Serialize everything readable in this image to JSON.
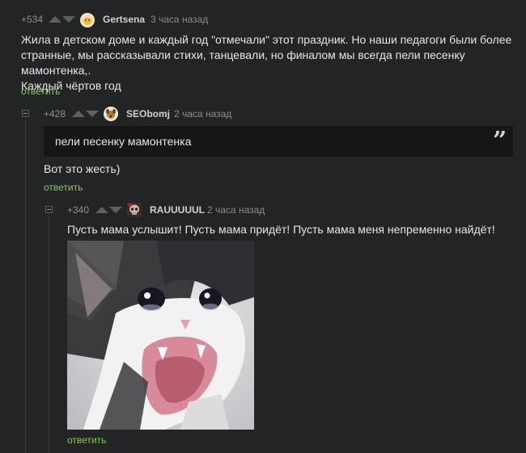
{
  "comments": [
    {
      "rating": "+534",
      "username": "Gertsena",
      "time": "3 часа назад",
      "text_lines": [
        "Жила в детском доме и каждый год \"отмечали\" этот праздник. Но наши педагоги были более",
        "странные, мы рассказывали стихи, танцевали, но финалом мы всегда пели песенку мамонтенка,.",
        "Каждый чёртов год"
      ],
      "reply_label": "ответить",
      "avatar_icon": "sun-avatar-icon"
    },
    {
      "rating": "+428",
      "username": "SEObomj",
      "time": "2 часа назад",
      "quote": "пели песенку мамонтенка",
      "quote_mark": "”",
      "text": "Вот это жесть)",
      "reply_label": "ответить",
      "avatar_icon": "dog-avatar-icon"
    },
    {
      "rating": "+340",
      "username": "RAUUUUUL",
      "time": "2 часа назад",
      "text": "Пусть мама услышит! Пусть мама придёт! Пусть мама меня непременно найдёт!",
      "image_icon": "crying-cat-image",
      "reply_label": "ответить",
      "avatar_icon": "skull-avatar-icon"
    }
  ],
  "colors": {
    "background": "#232425",
    "reply": "#8ac858",
    "quote_bg": "#151616"
  }
}
